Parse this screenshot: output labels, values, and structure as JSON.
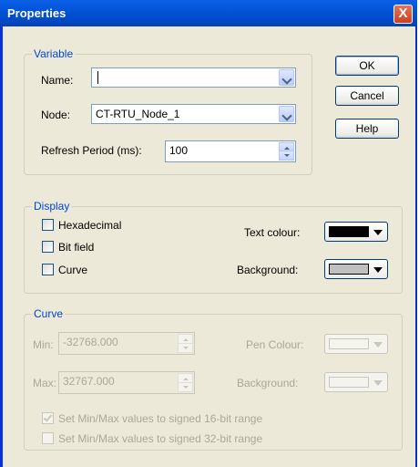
{
  "window": {
    "title": "Properties",
    "close_glyph": "X"
  },
  "variable": {
    "legend": "Variable",
    "name_label": "Name:",
    "name_value": "",
    "node_label": "Node:",
    "node_value": "CT-RTU_Node_1",
    "refresh_label": "Refresh Period (ms):",
    "refresh_value": "100"
  },
  "buttons": {
    "ok": "OK",
    "cancel": "Cancel",
    "help": "Help"
  },
  "display": {
    "legend": "Display",
    "hexadecimal_label": "Hexadecimal",
    "hexadecimal_checked": false,
    "bitfield_label": "Bit field",
    "bitfield_checked": false,
    "curve_label": "Curve",
    "curve_checked": false,
    "text_colour_label": "Text colour:",
    "text_colour": "#000000",
    "background_label": "Background:",
    "background_colour": "#c0c0c0"
  },
  "curve": {
    "legend": "Curve",
    "min_label": "Min:",
    "min_value": "-32768.000",
    "max_label": "Max:",
    "max_value": "32767.000",
    "pen_colour_label": "Pen Colour:",
    "background_label": "Background:",
    "signed16_label": "Set Min/Max values to signed 16-bit range",
    "signed16_checked": true,
    "signed32_label": "Set Min/Max values to signed 32-bit range",
    "signed32_checked": false
  }
}
